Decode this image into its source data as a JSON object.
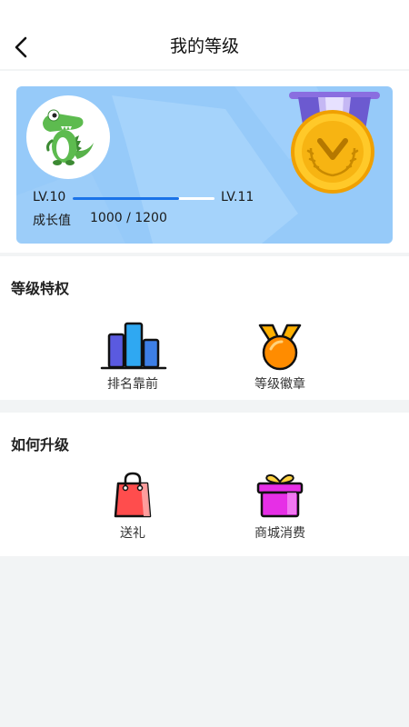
{
  "header": {
    "title": "我的等级"
  },
  "level_card": {
    "current_level": "LV.10",
    "next_level": "LV.11",
    "progress": 0.75,
    "growth_label": "成长值",
    "growth_value": "1000 / 1200"
  },
  "privileges": {
    "title": "等级特权",
    "items": [
      {
        "label": "排名靠前",
        "icon": "bar-chart-icon"
      },
      {
        "label": "等级徽章",
        "icon": "badge-medal-icon"
      }
    ]
  },
  "upgrade": {
    "title": "如何升级",
    "items": [
      {
        "label": "送礼",
        "icon": "shopping-bag-icon"
      },
      {
        "label": "商城消费",
        "icon": "gift-box-icon"
      }
    ]
  },
  "colors": {
    "card_bg": "#96caf9",
    "progress_fill": "#1b73e8",
    "page_bg": "#f2f4f5"
  }
}
